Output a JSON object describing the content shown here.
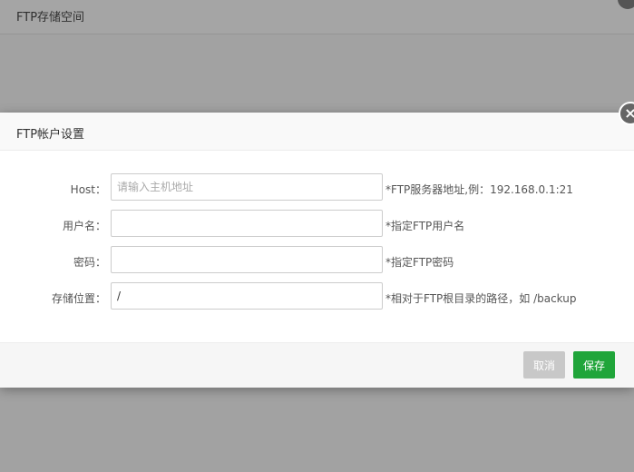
{
  "background_window": {
    "title": "FTP存储空间"
  },
  "dialog": {
    "title": "FTP帐户设置",
    "close_glyph": "×",
    "fields": {
      "host": {
        "label": "Host：",
        "value": "",
        "placeholder": "请输入主机地址",
        "hint": "*FTP服务器地址,例：192.168.0.1:21"
      },
      "username": {
        "label": "用户名：",
        "value": "",
        "placeholder": "",
        "hint": "*指定FTP用户名"
      },
      "password": {
        "label": "密码：",
        "value": "",
        "placeholder": "",
        "hint": "*指定FTP密码"
      },
      "storage_path": {
        "label": "存储位置：",
        "value": "/",
        "placeholder": "",
        "hint": "*相对于FTP根目录的路径，如 /backup"
      }
    },
    "buttons": {
      "cancel": "取消",
      "save": "保存"
    }
  },
  "colors": {
    "save_button": "#20a53a",
    "cancel_button": "#c8c8c8",
    "overlay": "#a2a2a2"
  }
}
